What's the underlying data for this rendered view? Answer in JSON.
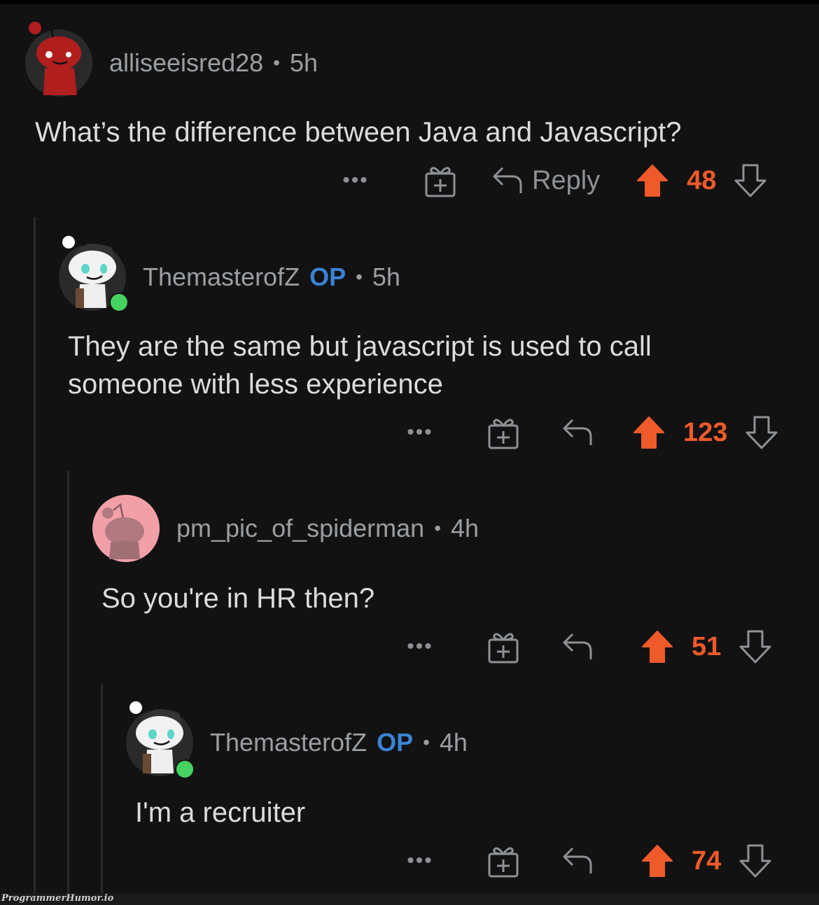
{
  "colors": {
    "background": "#121212",
    "upvote": "#ef5a2b",
    "op_badge": "#3a83d6",
    "online": "#46d160",
    "meta_text": "#9b9fa3"
  },
  "comments": [
    {
      "username": "alliseeisred28",
      "is_op": false,
      "time": "5h",
      "body": "What’s the difference between Java and Javascript?",
      "avatar": "red-snoo-avatar",
      "online": false,
      "actions": {
        "more": "•••",
        "award": "gift-plus-icon",
        "reply_label": "Reply",
        "score": "48"
      }
    },
    {
      "username": "ThemasterofZ",
      "is_op": true,
      "op_label": "OP",
      "time": "5h",
      "body": "They are the same but javascript is used to call someone with less experience",
      "avatar": "white-snoo-avatar",
      "online": true,
      "actions": {
        "more": "•••",
        "award": "gift-plus-icon",
        "score": "123"
      }
    },
    {
      "username": "pm_pic_of_spiderman",
      "is_op": false,
      "time": "4h",
      "body": "So you're in HR then?",
      "avatar": "pink-snoo-avatar",
      "online": false,
      "actions": {
        "more": "•••",
        "award": "gift-plus-icon",
        "score": "51"
      }
    },
    {
      "username": "ThemasterofZ",
      "is_op": true,
      "op_label": "OP",
      "time": "4h",
      "body": "I'm a recruiter",
      "avatar": "white-snoo-avatar",
      "online": true,
      "actions": {
        "more": "•••",
        "award": "gift-plus-icon",
        "score": "74"
      }
    }
  ],
  "watermark": "ProgrammerHumor.io"
}
